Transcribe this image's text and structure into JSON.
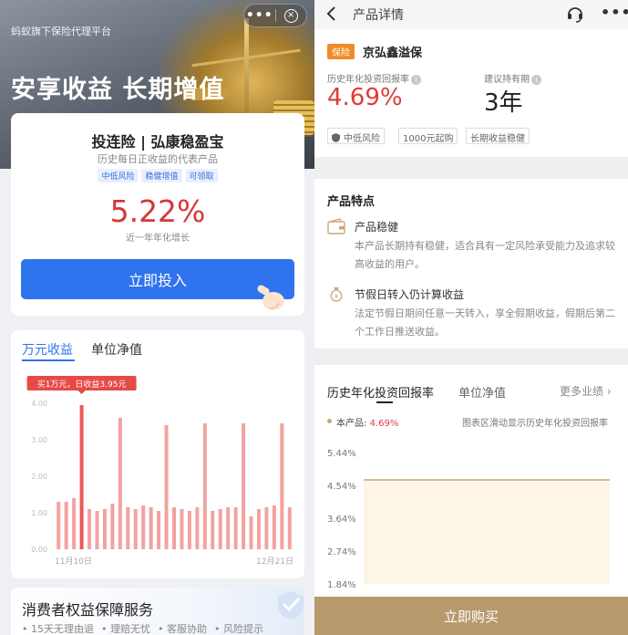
{
  "left": {
    "platform_name": "蚂蚁旗下保险代理平台",
    "capsule": {
      "more": "•••",
      "close": "×"
    },
    "slogan": "安享收益 长期增值",
    "product": {
      "title": "投连险 | 弘康稳盈宝",
      "subtitle": "历史每日正收益的代表产品",
      "tags": [
        "中低风险",
        "稳健增值",
        "可领取"
      ],
      "rate": "5.22%",
      "rate_label": "近一年年化增长",
      "invest_button": "立即投入"
    },
    "chart_tabs": [
      "万元收益",
      "单位净值"
    ],
    "rights": {
      "title": "消费者权益保障服务",
      "items": [
        "• 15天无理由退",
        "• 理赔无忧",
        "• 客服协助",
        "• 风险提示"
      ]
    }
  },
  "right": {
    "nav": {
      "title": "产品详情"
    },
    "badge": "保险",
    "product_name": "京弘鑫溢保",
    "rate_label": "历史年化投资回报率",
    "rate": "4.69%",
    "period_label": "建议持有期",
    "period": "3年",
    "tags": [
      "中低风险",
      "1000元起购",
      "长期收益稳健"
    ],
    "features_title": "产品特点",
    "features": [
      {
        "title": "产品稳健",
        "desc": "本产品长期持有稳健，适合具有一定风险承受能力及追求较高收益的用户。"
      },
      {
        "title": "节假日转入仍计算收益",
        "desc": "法定节假日期间任意一天转入，享全假期收益，假期后第二个工作日推送收益。"
      }
    ],
    "perf_tabs": [
      "历史年化投资回报率",
      "单位净值"
    ],
    "more_link": "更多业绩",
    "legend": {
      "label": "本产品:",
      "value": "4.69%"
    },
    "hint": "图表区滑动显示历史年化投资回报率",
    "buy_button": "立即购买"
  },
  "chart_data": [
    {
      "type": "bar",
      "title": "",
      "tooltip": "买1万元，日收益3.95元",
      "x_start_label": "11月10日",
      "x_end_label": "12月21日",
      "y_ticks": [
        "4.00",
        "3.00",
        "2.00",
        "1.00",
        "0.00"
      ],
      "ylim": [
        0,
        4.2
      ],
      "values": [
        1.3,
        1.3,
        1.4,
        3.95,
        1.1,
        1.05,
        1.1,
        1.25,
        3.6,
        1.15,
        1.1,
        1.2,
        1.15,
        1.05,
        3.4,
        1.15,
        1.1,
        1.05,
        1.15,
        3.45,
        1.05,
        1.1,
        1.15,
        1.15,
        3.45,
        0.9,
        1.1,
        1.15,
        1.2,
        3.45,
        1.15
      ],
      "color": "#f2a2a0",
      "highlight_color": "#e85a58",
      "grid": false
    },
    {
      "type": "area",
      "series": [
        {
          "name": "本产品",
          "values": [
            4.69,
            4.69,
            4.69,
            4.69,
            4.69,
            4.69,
            4.69,
            4.69,
            4.69,
            4.69
          ]
        }
      ],
      "y_ticks": [
        "5.44%",
        "4.54%",
        "3.64%",
        "2.74%",
        "1.84%"
      ],
      "ylim": [
        1.84,
        5.44
      ],
      "color": "#c9a77a",
      "fill": "#fdf5e6",
      "grid": false
    }
  ],
  "colors": {
    "primary_blue": "#2f73ee",
    "rate_red": "#e13a3a",
    "gold": "#b7996b",
    "badge_orange": "#f08a24"
  }
}
